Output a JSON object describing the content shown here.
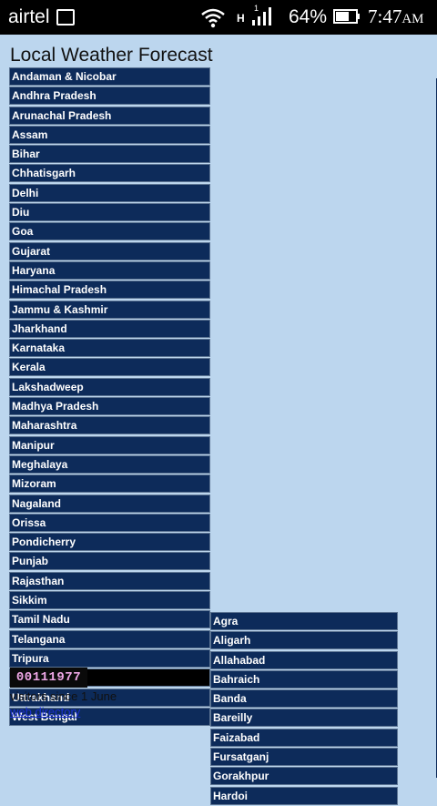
{
  "status_bar": {
    "carrier": "airtel",
    "network_type": "H",
    "battery": "64%",
    "time": "7:47",
    "ampm": "AM"
  },
  "page": {
    "title": "Local Weather Forecast",
    "visitor_counter": "00111977",
    "visitors_text": "visitors since 1 June",
    "web_directory_link": "web directory"
  },
  "states": [
    "Andaman & Nicobar",
    "Andhra Pradesh",
    "Arunachal Pradesh",
    "Assam",
    "Bihar",
    "Chhatisgarh",
    "Delhi",
    "Diu",
    "Goa",
    "Gujarat",
    "Haryana",
    "Himachal Pradesh",
    "Jammu & Kashmir",
    "Jharkhand",
    "Karnataka",
    "Kerala",
    "Lakshadweep",
    "Madhya Pradesh",
    "Maharashtra",
    "Manipur",
    "Meghalaya",
    "Mizoram",
    "Nagaland",
    "Orissa",
    "Pondicherry",
    "Punjab",
    "Rajasthan",
    "Sikkim",
    "Tamil Nadu",
    "Telangana",
    "Tripura",
    "Uttar Pradesh",
    "Uttrakhand",
    "West Bengal"
  ],
  "selected_state": "Uttar Pradesh",
  "cities": [
    "Agra",
    "Aligarh",
    "Allahabad",
    "Bahraich",
    "Banda",
    "Bareilly",
    "Faizabad",
    "Fursatganj",
    "Gorakhpur",
    "Hardoi"
  ]
}
